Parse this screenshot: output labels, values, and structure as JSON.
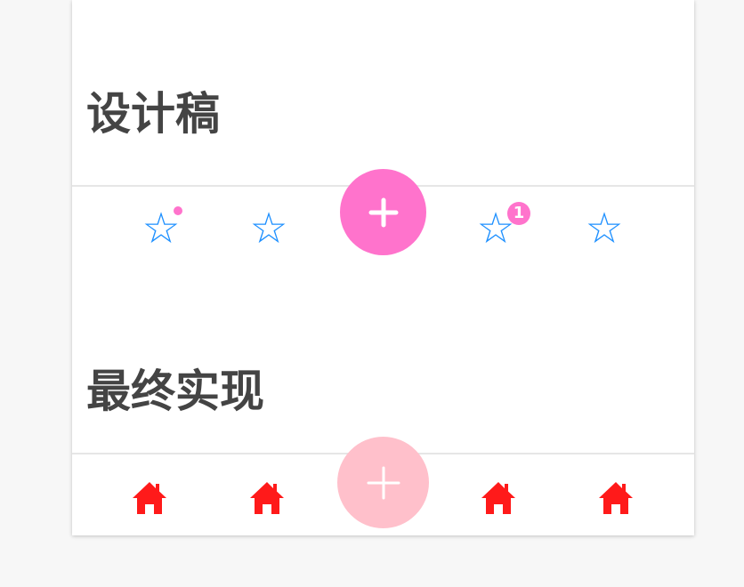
{
  "colors": {
    "page_bg": "#f7f7f7",
    "card_bg": "#ffffff",
    "title_text": "#444444",
    "divider": "#e6e6e6",
    "star_blue": "#1e90ff",
    "fab_pink": "#ff73cc",
    "fab_light_pink": "#ffc0cb",
    "home_red": "#ff1a1a",
    "badge_pink": "#ff73cc"
  },
  "section_design": {
    "title": "设计稿",
    "tabbar": {
      "tabs": [
        {
          "icon": "star-outline-icon",
          "indicator": "dot"
        },
        {
          "icon": "star-outline-icon",
          "indicator": "none"
        },
        {
          "icon": "plus-icon",
          "type": "fab"
        },
        {
          "icon": "star-outline-icon",
          "indicator": "badge",
          "badge_count": "1"
        },
        {
          "icon": "star-outline-icon",
          "indicator": "none"
        }
      ]
    }
  },
  "section_final": {
    "title": "最终实现",
    "tabbar": {
      "tabs": [
        {
          "icon": "home-icon"
        },
        {
          "icon": "home-icon"
        },
        {
          "icon": "plus-icon",
          "type": "fab"
        },
        {
          "icon": "home-icon"
        },
        {
          "icon": "home-icon"
        }
      ]
    }
  }
}
